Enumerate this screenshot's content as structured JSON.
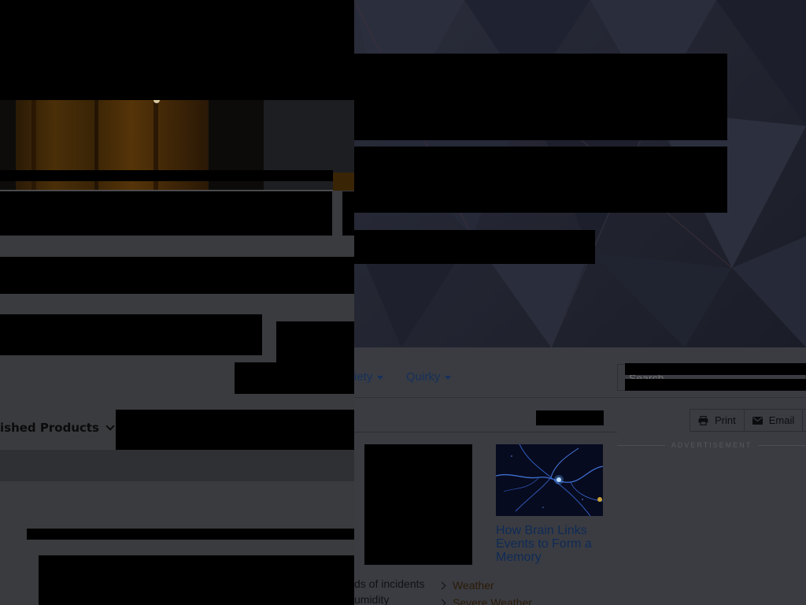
{
  "nav": {
    "items": [
      {
        "label": "iety",
        "has_dropdown": true
      },
      {
        "label": "Quirky",
        "has_dropdown": true
      }
    ],
    "search": {
      "placeholder": "Search"
    }
  },
  "toolbar": {
    "print_label": "Print",
    "email_label": "Email"
  },
  "ad": {
    "label": "ADVERTISEMENT"
  },
  "featured": {
    "title": "How Brain Links Events to Form a Memory",
    "image_icon": "neuron-image"
  },
  "snippets": [
    "ds of incidents",
    "umidity"
  ],
  "side_links": [
    {
      "label": "Weather",
      "icon": "chevron-right-icon"
    },
    {
      "label": "Severe Weather",
      "icon": "chevron-right-icon"
    }
  ],
  "left": {
    "published_products_label": "ished Products",
    "icon": "chevron-down-icon"
  },
  "colors": {
    "link": "#16305a",
    "side_link": "#2b1a06",
    "hero_bg": "#232634",
    "panel_bg": "#3a3b3e"
  }
}
